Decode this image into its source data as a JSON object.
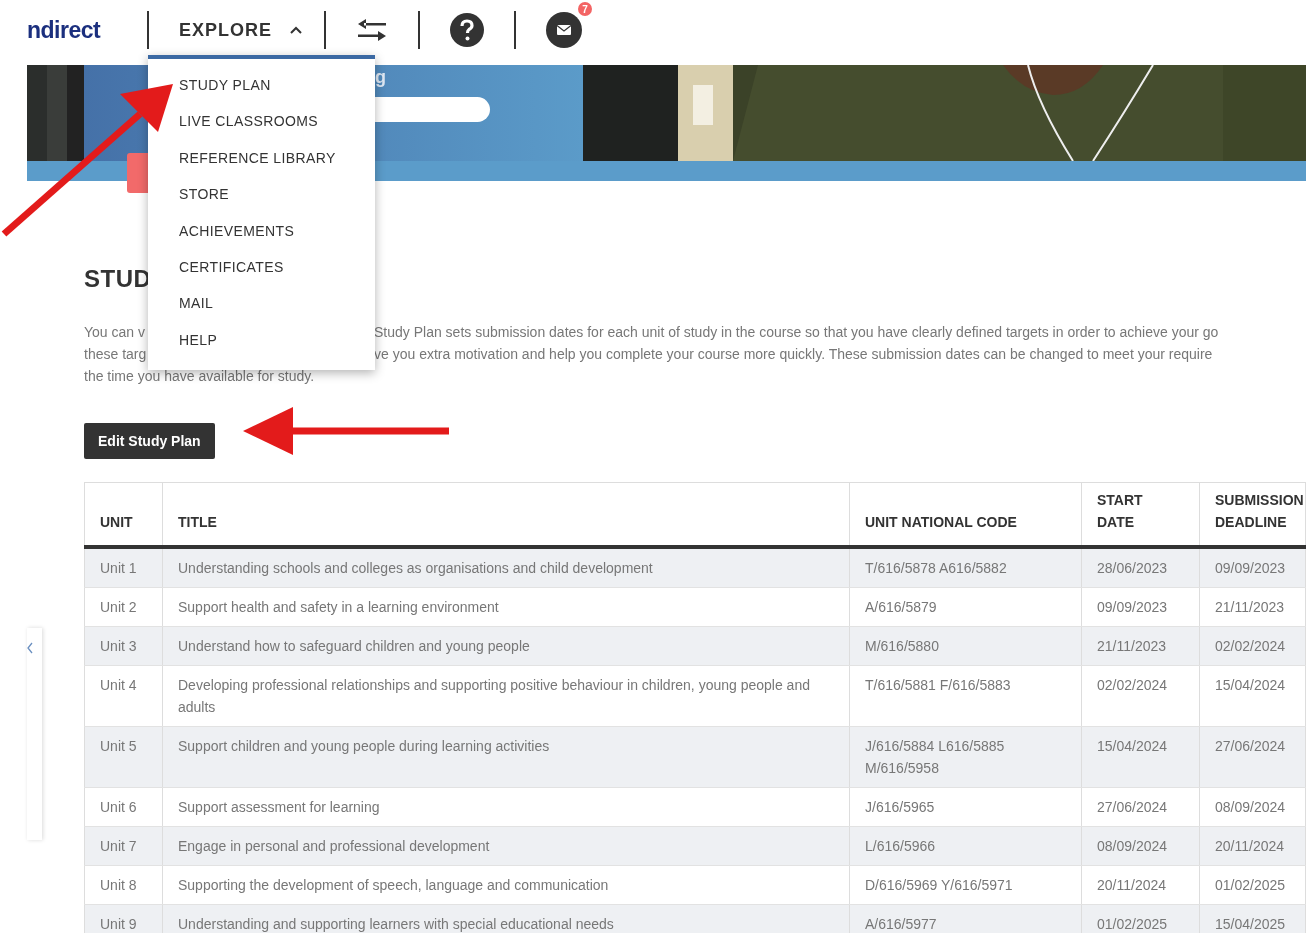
{
  "header": {
    "logo": "ndirect",
    "explore": {
      "label": "EXPLORE",
      "expanded": true
    },
    "mail_badge": "7"
  },
  "banner": {
    "heading_fragment": "g"
  },
  "explore_menu": [
    "STUDY PLAN",
    "LIVE CLASSROOMS",
    "REFERENCE LIBRARY",
    "STORE",
    "ACHIEVEMENTS",
    "CERTIFICATES",
    "MAIL",
    "HELP"
  ],
  "section": {
    "heading": "STUD",
    "paragraph_lines": [
      {
        "left": "You can v",
        "right": "Study Plan sets submission dates for each unit of study in the course so that you have clearly defined targets in order to achieve your go"
      },
      {
        "left": "these targ",
        "right": "ve you extra motivation and help you complete your course more quickly. These submission dates can be changed to meet your require"
      },
      {
        "left": "the time you have available for study."
      }
    ],
    "edit_button": "Edit Study Plan"
  },
  "table": {
    "columns": [
      "UNIT",
      "TITLE",
      "UNIT NATIONAL CODE",
      "START DATE",
      "SUBMISSION DEADLINE"
    ],
    "rows": [
      [
        "Unit 1",
        "Understanding schools and colleges as organisations and child development",
        "T/616/5878 A616/5882",
        "28/06/2023",
        "09/09/2023"
      ],
      [
        "Unit 2",
        "Support health and safety in a learning environment",
        "A/616/5879",
        "09/09/2023",
        "21/11/2023"
      ],
      [
        "Unit 3",
        "Understand how to safeguard children and young people",
        "M/616/5880",
        "21/11/2023",
        "02/02/2024"
      ],
      [
        "Unit 4",
        "Developing professional relationships and supporting positive behaviour in children, young people and adults",
        "T/616/5881 F/616/5883",
        "02/02/2024",
        "15/04/2024"
      ],
      [
        "Unit 5",
        "Support children and young people during learning activities",
        "J/616/5884 L616/5885 M/616/5958",
        "15/04/2024",
        "27/06/2024"
      ],
      [
        "Unit 6",
        "Support assessment for learning",
        "J/616/5965",
        "27/06/2024",
        "08/09/2024"
      ],
      [
        "Unit 7",
        "Engage in personal and professional development",
        "L/616/5966",
        "08/09/2024",
        "20/11/2024"
      ],
      [
        "Unit 8",
        "Supporting the development of speech, language and communication",
        "D/616/5969 Y/616/5971",
        "20/11/2024",
        "01/02/2025"
      ],
      [
        "Unit 9",
        "Understanding and supporting learners with special educational needs",
        "A/616/5977",
        "01/02/2025",
        "15/04/2025"
      ]
    ]
  }
}
